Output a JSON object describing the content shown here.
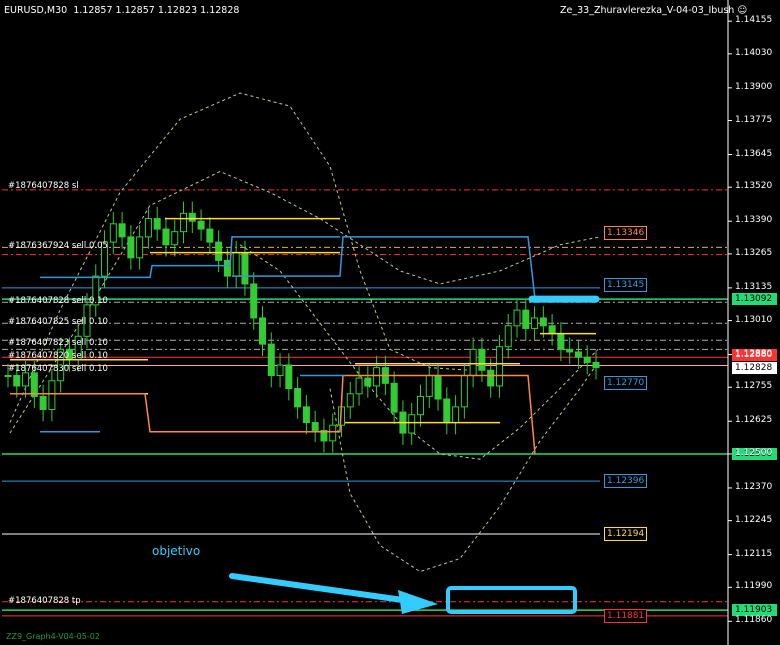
{
  "header": {
    "symbol": "EURUSD,M30",
    "ohlc": "1.12857 1.12857 1.12823 1.12828",
    "indicator": "Ze_33_Zhuravlerezka_V-04-03_Ibush"
  },
  "order_labels": [
    {
      "text": "#1876407828 sl",
      "price": 1.1352
    },
    {
      "text": "#1876367924 sell 0.05",
      "price": 1.1329
    },
    {
      "text": "#1876407828 sell 0.10",
      "price": 1.1308
    },
    {
      "text": "#1876407825 sell 0.10",
      "price": 1.13
    },
    {
      "text": "#1876407823 sell 0.10",
      "price": 1.1292
    },
    {
      "text": "#1876407820 sell 0.10",
      "price": 1.1287
    },
    {
      "text": "#1876407830 sell 0.10",
      "price": 1.1282
    },
    {
      "text": "#1876407828 tp",
      "price": 1.11935
    }
  ],
  "annotation": {
    "text": "objetivo",
    "color": "#33ccff"
  },
  "footer": "ZZ9_Graph4-V04-05-02",
  "colors": {
    "background": "#000000",
    "candle": "#33cc33",
    "yellow": "#ffdd33",
    "orange": "#ff8844",
    "blue": "#3399dd",
    "cyan": "#33ccff",
    "green_line": "#22dd77",
    "red_line": "#ff3333",
    "dashed": "#b9cf8a"
  },
  "chart_data": {
    "type": "line",
    "symbol": "EURUSD",
    "timeframe": "M30",
    "price_axis_ticks": [
      1.14155,
      1.1403,
      1.139,
      1.13775,
      1.13645,
      1.1352,
      1.1339,
      1.13265,
      1.13135,
      1.1301,
      1.1288,
      1.12755,
      1.12625,
      1.125,
      1.1237,
      1.12245,
      1.12115,
      1.1199,
      1.1186
    ],
    "ylim": [
      1.118,
      1.1419
    ],
    "price_tags": [
      {
        "value": "1.13346",
        "kind": "tag",
        "color": "#ff8844"
      },
      {
        "value": "1.13145",
        "kind": "tag",
        "color": "#3399dd"
      },
      {
        "value": "1.13092",
        "kind": "box",
        "color": "#22dd77"
      },
      {
        "value": "1.12880",
        "kind": "box",
        "color": "#ff3333"
      },
      {
        "value": "1.12828",
        "kind": "box",
        "color": "#ffffff"
      },
      {
        "value": "1.12770",
        "kind": "tag",
        "color": "#3399dd"
      },
      {
        "value": "1.12500",
        "kind": "box",
        "color": "#22dd77"
      },
      {
        "value": "1.12396",
        "kind": "tag",
        "color": "#3399dd"
      },
      {
        "value": "1.12194",
        "kind": "tag",
        "color": "#ffdd33"
      },
      {
        "value": "1.11903",
        "kind": "box",
        "color": "#22dd77"
      },
      {
        "value": "1.11881",
        "kind": "tag",
        "color": "#ff3333"
      }
    ],
    "close_series": [
      1.128,
      1.1276,
      1.1281,
      1.1272,
      1.1267,
      1.1278,
      1.129,
      1.1286,
      1.1295,
      1.1307,
      1.1318,
      1.1331,
      1.1338,
      1.1333,
      1.1325,
      1.1333,
      1.134,
      1.1336,
      1.133,
      1.1335,
      1.1342,
      1.1339,
      1.1336,
      1.1331,
      1.1324,
      1.1318,
      1.1327,
      1.1315,
      1.1302,
      1.1292,
      1.128,
      1.1284,
      1.1275,
      1.1268,
      1.1262,
      1.1259,
      1.1255,
      1.1261,
      1.1268,
      1.1273,
      1.1279,
      1.1276,
      1.1283,
      1.1277,
      1.1266,
      1.1258,
      1.1265,
      1.1272,
      1.128,
      1.1271,
      1.1262,
      1.1268,
      1.128,
      1.129,
      1.1282,
      1.1276,
      1.1291,
      1.1299,
      1.1305,
      1.1298,
      1.1302,
      1.1299,
      1.1296,
      1.129,
      1.1289,
      1.1287,
      1.1285,
      1.1283
    ]
  }
}
